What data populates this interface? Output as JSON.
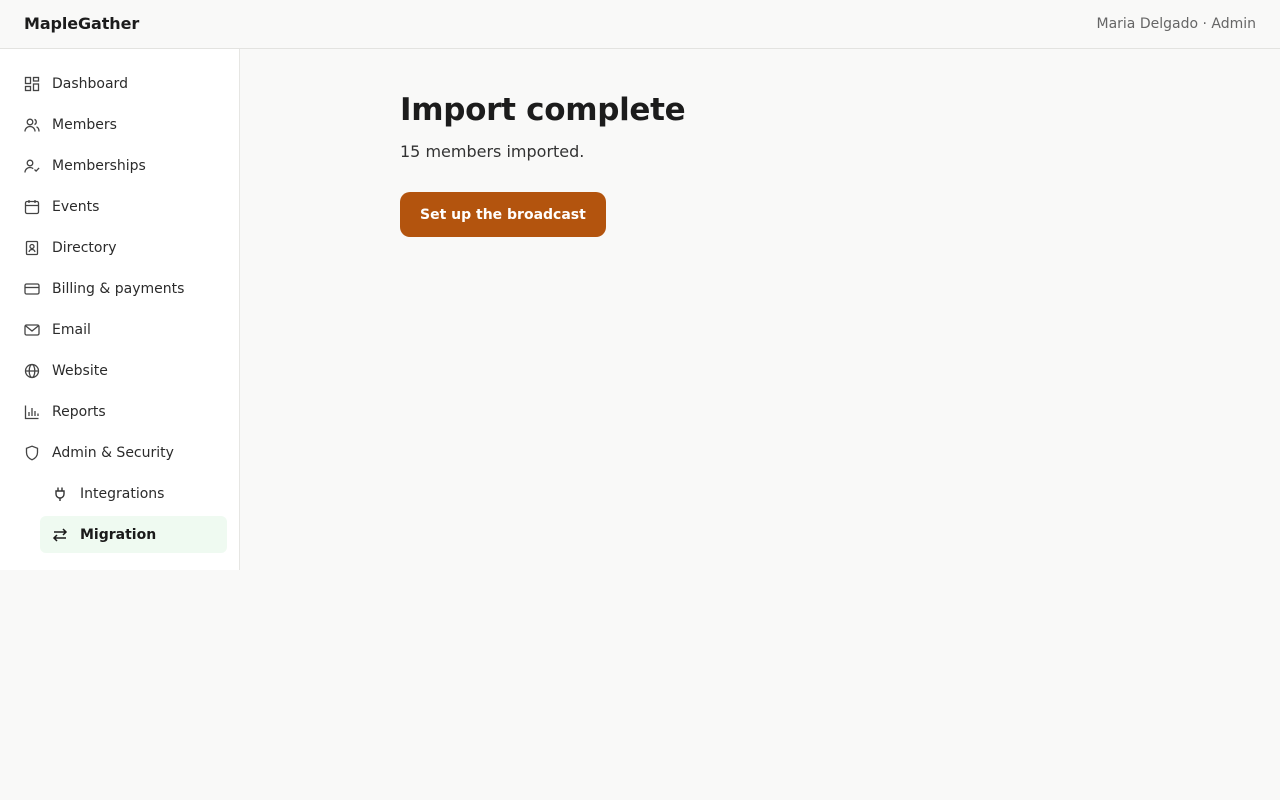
{
  "app": {
    "brand": "MapleGather",
    "user": "Maria Delgado · Admin"
  },
  "sidebar": {
    "items": [
      {
        "label": "Dashboard",
        "icon": "dashboard-icon"
      },
      {
        "label": "Members",
        "icon": "users-icon"
      },
      {
        "label": "Memberships",
        "icon": "user-check-icon"
      },
      {
        "label": "Events",
        "icon": "calendar-icon"
      },
      {
        "label": "Directory",
        "icon": "contact-book-icon"
      },
      {
        "label": "Billing & payments",
        "icon": "credit-card-icon"
      },
      {
        "label": "Email",
        "icon": "mail-icon"
      },
      {
        "label": "Website",
        "icon": "globe-icon"
      },
      {
        "label": "Reports",
        "icon": "bar-chart-icon"
      },
      {
        "label": "Admin & Security",
        "icon": "shield-icon"
      }
    ],
    "subitems": [
      {
        "label": "Integrations",
        "icon": "plug-icon"
      },
      {
        "label": "Migration",
        "icon": "swap-arrows-icon",
        "active": true
      }
    ]
  },
  "main": {
    "title": "Import complete",
    "subtitle": "15 members imported.",
    "cta_label": "Set up the broadcast"
  },
  "colors": {
    "accent": "#b3540e",
    "active_bg": "#effaf1",
    "background": "#f9f9f8"
  }
}
